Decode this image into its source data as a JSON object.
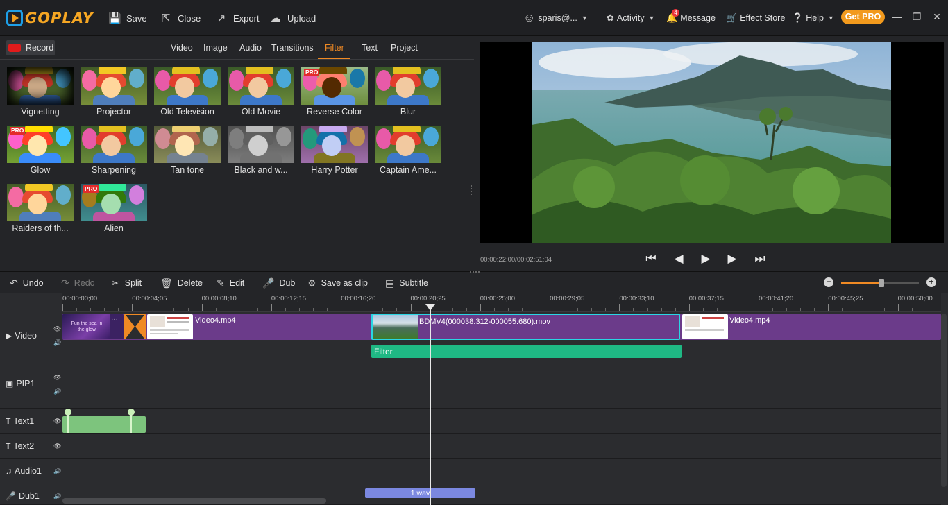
{
  "app": {
    "name": "GOPLAY",
    "colors": {
      "accent": "#f08a24",
      "pro_badge": "#f29a1d",
      "video_clip": "#6b3b8a",
      "filter_clip": "#1fb884",
      "text_clip": "#7dc47d",
      "dub_clip": "#7b88e0"
    }
  },
  "toolbar": {
    "save": "Save",
    "close": "Close",
    "export": "Export",
    "upload": "Upload",
    "icons": [
      "save-icon",
      "close-icon",
      "export-icon",
      "upload-icon"
    ]
  },
  "account": {
    "user": "sparis@...",
    "activity": "Activity",
    "message": "Message",
    "message_count": "4",
    "effect_store": "Effect Store",
    "help": "Help",
    "get_pro": "Get PRO"
  },
  "media_tabs": {
    "record": "Record",
    "tabs": [
      "Video",
      "Image",
      "Audio",
      "Transitions",
      "Filter",
      "Text",
      "Project"
    ],
    "active": "Filter"
  },
  "filters": [
    {
      "name": "Vignetting",
      "pro": false,
      "tint": "vignette"
    },
    {
      "name": "Projector",
      "pro": false,
      "tint": "warm"
    },
    {
      "name": "Old Television",
      "pro": false,
      "tint": "normal"
    },
    {
      "name": "Old Movie",
      "pro": false,
      "tint": "normal"
    },
    {
      "name": "Reverse Color",
      "pro": true,
      "tint": "invert"
    },
    {
      "name": "Blur",
      "pro": false,
      "tint": "normal"
    },
    {
      "name": "Glow",
      "pro": true,
      "tint": "bright"
    },
    {
      "name": "Sharpening",
      "pro": false,
      "tint": "normal"
    },
    {
      "name": "Tan tone",
      "pro": false,
      "tint": "tan"
    },
    {
      "name": "Black and w...",
      "pro": false,
      "tint": "gray"
    },
    {
      "name": "Harry Potter",
      "pro": false,
      "tint": "cool"
    },
    {
      "name": "Captain Ame...",
      "pro": false,
      "tint": "normal"
    },
    {
      "name": "Raiders of th...",
      "pro": false,
      "tint": "warm"
    },
    {
      "name": "Alien",
      "pro": true,
      "tint": "alien"
    }
  ],
  "preview": {
    "timecode": "00:00:22:00/00:02:51:04",
    "controls": [
      "skip-back-icon",
      "step-back-icon",
      "play-icon",
      "step-forward-icon",
      "skip-forward-icon"
    ]
  },
  "edit_toolbar": {
    "undo": "Undo",
    "redo": "Redo",
    "split": "Split",
    "delete": "Delete",
    "edit": "Edit",
    "dub": "Dub",
    "save_as_clip": "Save as clip",
    "subtitle": "Subtitle",
    "zoom_level": 0.52
  },
  "timeline": {
    "ruler": [
      "00:00:00;00",
      "00:00:04;05",
      "00:00:08;10",
      "00:00:12;15",
      "00:00:16;20",
      "00:00:20;25",
      "00:00:25;00",
      "00:00:29;05",
      "00:00:33;10",
      "00:00:37;15",
      "00:00:41;20",
      "00:00:45;25",
      "00:00:50;00"
    ],
    "tracks": [
      {
        "name": "Video",
        "icon": "video-track-icon"
      },
      {
        "name": "PIP1",
        "icon": "pip-track-icon"
      },
      {
        "name": "Text1",
        "icon": "text-track-icon"
      },
      {
        "name": "Text2",
        "icon": "text-track-icon"
      },
      {
        "name": "Audio1",
        "icon": "music-track-icon"
      },
      {
        "name": "Dub1",
        "icon": "mic-track-icon"
      }
    ],
    "clips": {
      "video_clip_1": "Video4.mp4",
      "video_clip_2": "BDMV4(000038.312-000055.680).mov",
      "video_clip_3": "Video4.mp4",
      "filter_clip": "Filter",
      "dub_clip": "1.wav",
      "intro_text": "Fun the sea In the glow"
    }
  }
}
